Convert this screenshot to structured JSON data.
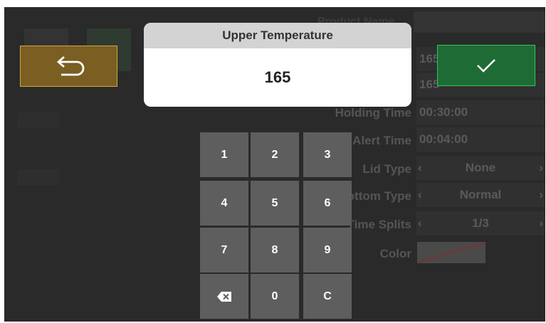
{
  "dialog": {
    "title": "Upper Temperature",
    "value": "165"
  },
  "keypad": {
    "keys": [
      "1",
      "2",
      "3",
      "4",
      "5",
      "6",
      "7",
      "8",
      "9",
      "⌫",
      "0",
      "C"
    ]
  },
  "background_form": {
    "header": "Product Name",
    "upper_value": "165",
    "lower_value": "165",
    "holding_time_label": "Holding Time",
    "holding_time_value": "00:30:00",
    "alert_time_label": "Alert Time",
    "alert_time_value": "00:04:00",
    "lid_type_label": "Lid Type",
    "lid_type_value": "None",
    "bottom_type_label": "Bottom Type",
    "bottom_type_value": "Normal",
    "splits_label": "Time Splits",
    "splits_value": "1/3",
    "color_label": "Color"
  },
  "colors": {
    "back_button": "#7a5e22",
    "ok_button": "#1f6b36",
    "key": "#5e5e5e"
  },
  "icons": {
    "back": "return-arrow-icon",
    "ok": "checkmark-icon",
    "backspace": "backspace-icon"
  }
}
